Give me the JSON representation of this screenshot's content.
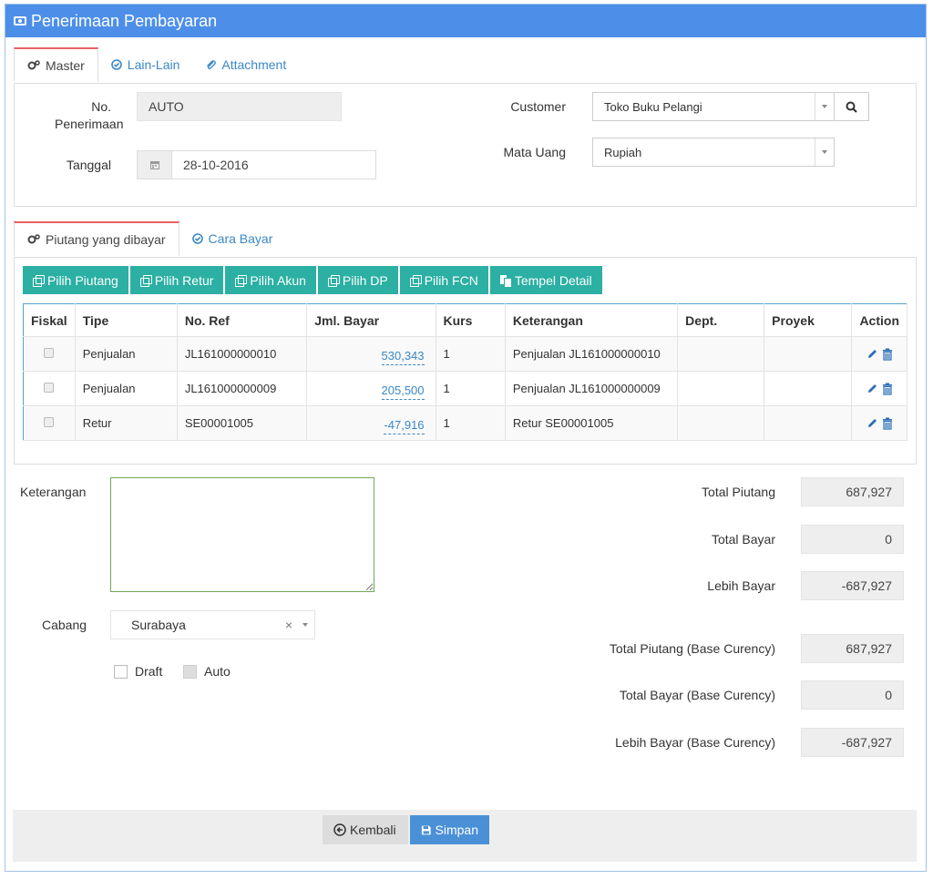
{
  "title": "Penerimaan Pembayaran",
  "top_tabs": [
    "Master",
    "Lain-Lain",
    "Attachment"
  ],
  "master": {
    "no_label": "No.",
    "no_label2": "Penerimaan",
    "no_value": "AUTO",
    "tanggal_label": "Tanggal",
    "tanggal_value": "28-10-2016",
    "customer_label": "Customer",
    "customer_value": "Toko Buku Pelangi",
    "currency_label": "Mata Uang",
    "currency_value": "Rupiah"
  },
  "detail_tabs": [
    "Piutang yang dibayar",
    "Cara Bayar"
  ],
  "toolbar": [
    "Pilih Piutang",
    "Pilih Retur",
    "Pilih Akun",
    "Pilih DP",
    "Pilih FCN",
    "Tempel Detail"
  ],
  "table": {
    "headers": [
      "Fiskal",
      "Tipe",
      "No. Ref",
      "Jml. Bayar",
      "Kurs",
      "Keterangan",
      "Dept.",
      "Proyek",
      "Action"
    ],
    "rows": [
      {
        "tipe": "Penjualan",
        "ref": "JL161000000010",
        "jml": "530,343",
        "kurs": "1",
        "ket": "Penjualan JL161000000010",
        "dept": "",
        "proyek": ""
      },
      {
        "tipe": "Penjualan",
        "ref": "JL161000000009",
        "jml": "205,500",
        "kurs": "1",
        "ket": "Penjualan JL161000000009",
        "dept": "",
        "proyek": ""
      },
      {
        "tipe": "Retur",
        "ref": "SE00001005",
        "jml": "-47,916",
        "kurs": "1",
        "ket": "Retur SE00001005",
        "dept": "",
        "proyek": ""
      }
    ]
  },
  "bottom": {
    "keterangan_label": "Keterangan",
    "cabang_label": "Cabang",
    "cabang_value": "Surabaya",
    "draft_label": "Draft",
    "auto_label": "Auto"
  },
  "summary": [
    {
      "label": "Total Piutang",
      "value": "687,927"
    },
    {
      "label": "Total Bayar",
      "value": "0"
    },
    {
      "label": "Lebih Bayar",
      "value": "-687,927"
    },
    {
      "label": "Total Piutang (Base Curency)",
      "value": "687,927"
    },
    {
      "label": "Total Bayar (Base Curency)",
      "value": "0"
    },
    {
      "label": "Lebih Bayar (Base Curency)",
      "value": "-687,927"
    }
  ],
  "footer": {
    "back": "Kembali",
    "save": "Simpan"
  },
  "colors": {
    "header": "#4d8fe8",
    "toolbar_btn": "#2bb0a3",
    "save_btn": "#4a90d6",
    "link": "#3a87c8",
    "tab_accent": "#e86165"
  }
}
